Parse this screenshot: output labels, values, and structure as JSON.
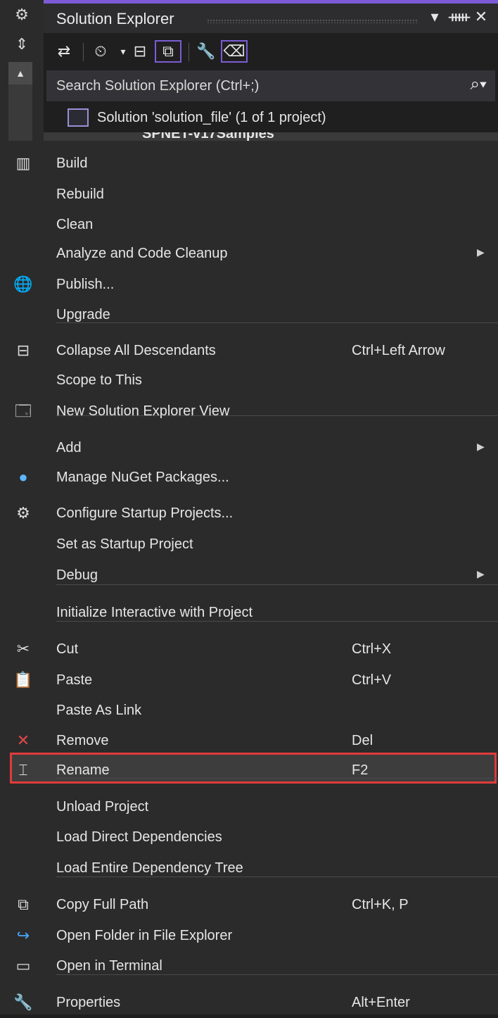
{
  "dock": {
    "icons": [
      "gear-icon",
      "pin-split-icon",
      "scroll-up-icon"
    ]
  },
  "solution_explorer": {
    "title": "Solution Explorer",
    "title_buttons": [
      "▼",
      "Ṗ",
      "✕"
    ],
    "search_placeholder": "Search Solution Explorer (Ctrl+;)",
    "solution_item": "Solution 'solution_file' (1 of 1 project)",
    "project_item_partial": "SPNET-v17Samples"
  },
  "menu": {
    "items": [
      {
        "label": "Build",
        "shortcut": "",
        "submenu": false,
        "icon": "build-icon"
      },
      {
        "label": "Rebuild",
        "shortcut": "",
        "submenu": false,
        "icon": ""
      },
      {
        "label": "Clean",
        "shortcut": "",
        "submenu": false,
        "icon": ""
      },
      {
        "label": "Analyze and Code Cleanup",
        "shortcut": "",
        "submenu": true,
        "icon": ""
      },
      {
        "label": "Publish...",
        "shortcut": "",
        "submenu": false,
        "icon": "publish-icon"
      },
      {
        "label": "Upgrade",
        "shortcut": "",
        "submenu": false,
        "icon": ""
      },
      {
        "label": "Collapse All Descendants",
        "shortcut": "Ctrl+Left Arrow",
        "submenu": false,
        "icon": "collapse-icon"
      },
      {
        "label": "Scope to This",
        "shortcut": "",
        "submenu": false,
        "icon": ""
      },
      {
        "label": "New Solution Explorer View",
        "shortcut": "",
        "submenu": false,
        "icon": "new-view-icon"
      },
      {
        "label": "Add",
        "shortcut": "",
        "submenu": true,
        "icon": ""
      },
      {
        "label": "Manage NuGet Packages...",
        "shortcut": "",
        "submenu": false,
        "icon": "nuget-icon"
      },
      {
        "label": "Configure Startup Projects...",
        "shortcut": "",
        "submenu": false,
        "icon": "settings-icon"
      },
      {
        "label": "Set as Startup Project",
        "shortcut": "",
        "submenu": false,
        "icon": ""
      },
      {
        "label": "Debug",
        "shortcut": "",
        "submenu": true,
        "icon": ""
      },
      {
        "label": "Initialize Interactive with Project",
        "shortcut": "",
        "submenu": false,
        "icon": ""
      },
      {
        "label": "Cut",
        "shortcut": "Ctrl+X",
        "submenu": false,
        "icon": "cut-icon"
      },
      {
        "label": "Paste",
        "shortcut": "Ctrl+V",
        "submenu": false,
        "icon": "paste-icon"
      },
      {
        "label": "Paste As Link",
        "shortcut": "",
        "submenu": false,
        "icon": ""
      },
      {
        "label": "Remove",
        "shortcut": "Del",
        "submenu": false,
        "icon": "remove-icon"
      },
      {
        "label": "Rename",
        "shortcut": "F2",
        "submenu": false,
        "icon": "rename-icon"
      },
      {
        "label": "Unload Project",
        "shortcut": "",
        "submenu": false,
        "icon": ""
      },
      {
        "label": "Load Direct Dependencies",
        "shortcut": "",
        "submenu": false,
        "icon": ""
      },
      {
        "label": "Load Entire Dependency Tree",
        "shortcut": "",
        "submenu": false,
        "icon": ""
      },
      {
        "label": "Copy Full Path",
        "shortcut": "Ctrl+K, P",
        "submenu": false,
        "icon": "copy-icon"
      },
      {
        "label": "Open Folder in File Explorer",
        "shortcut": "",
        "submenu": false,
        "icon": "open-folder-icon"
      },
      {
        "label": "Open in Terminal",
        "shortcut": "",
        "submenu": false,
        "icon": "terminal-icon"
      },
      {
        "label": "Properties",
        "shortcut": "Alt+Enter",
        "submenu": false,
        "icon": "wrench-icon"
      }
    ]
  },
  "colors": {
    "accent": "#7c5cd6",
    "highlight_border": "#e03b3b",
    "menu_bg": "#2b2b2b",
    "remove_icon": "#e04848",
    "link_icon": "#4aa8ff"
  }
}
